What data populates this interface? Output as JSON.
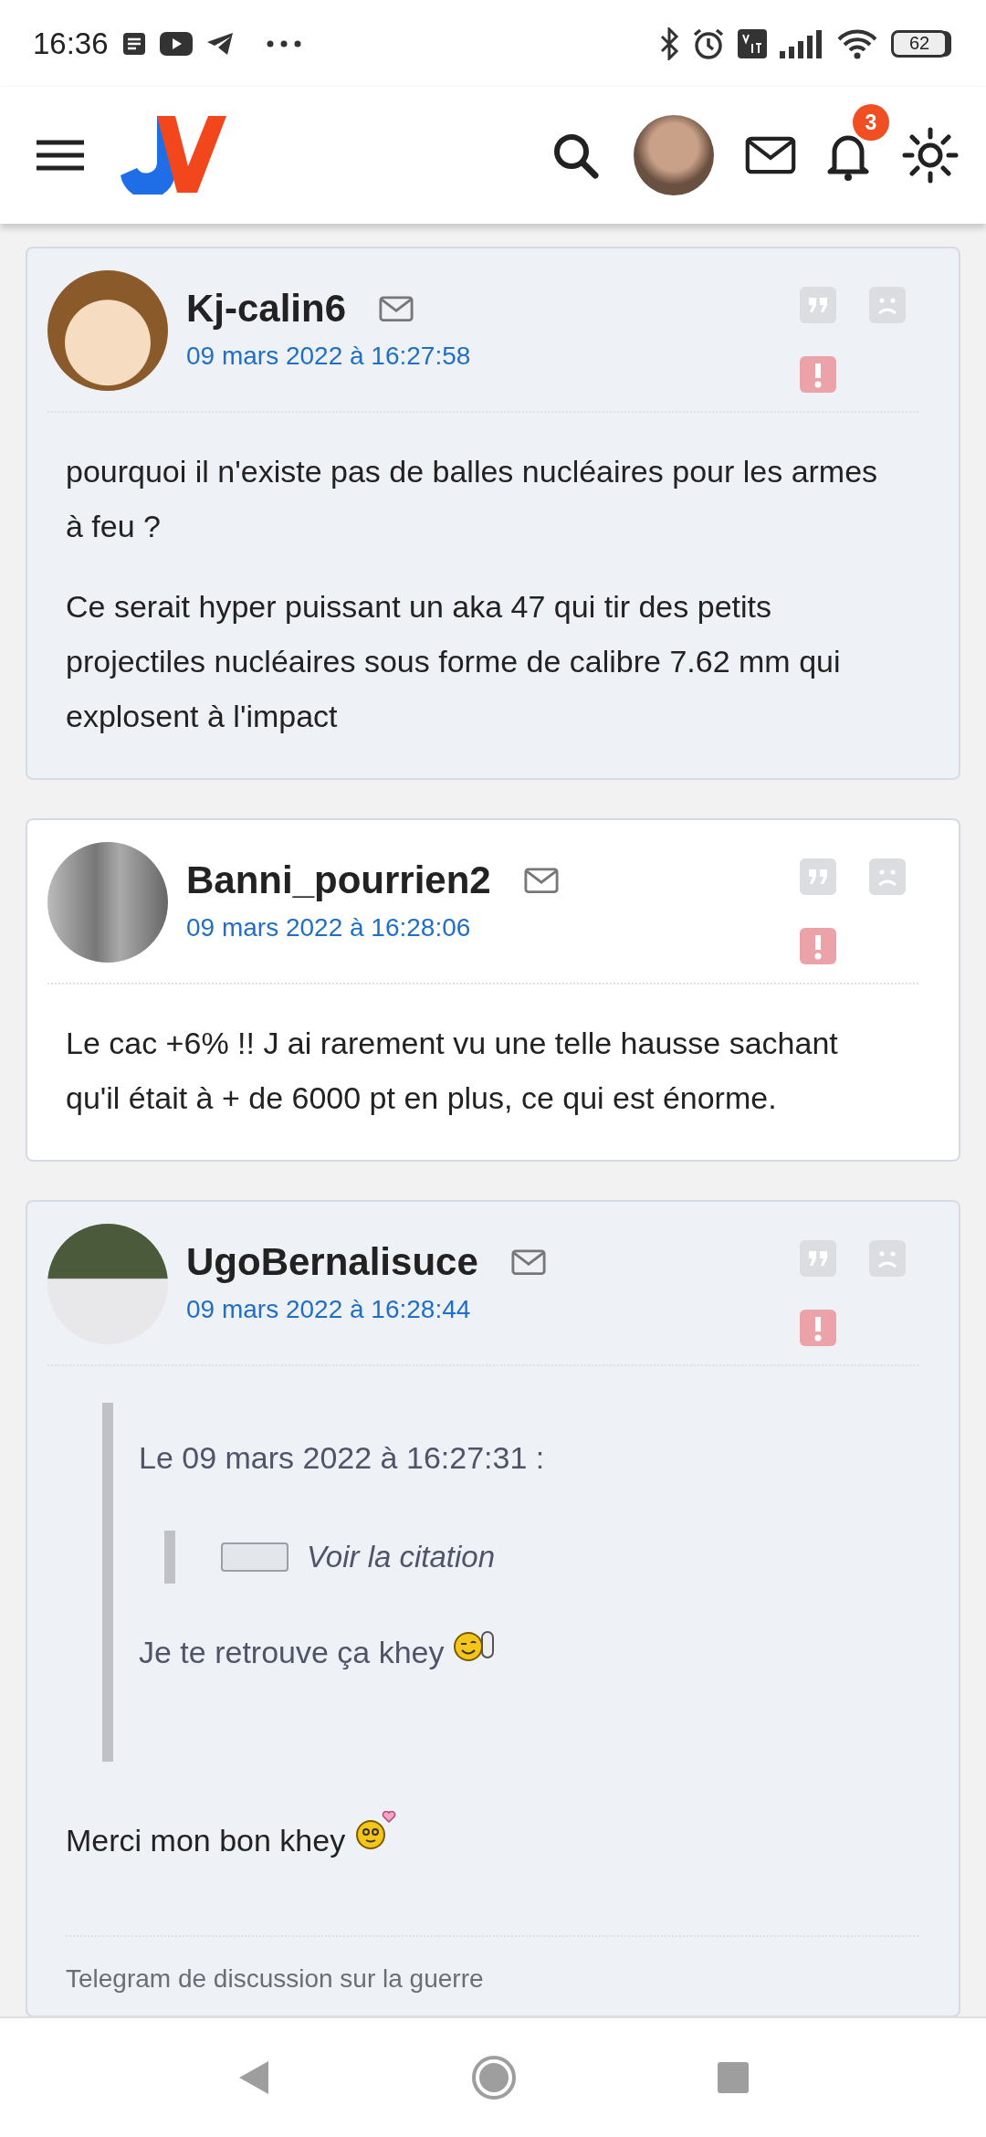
{
  "status_bar": {
    "time": "16:36",
    "battery": "62"
  },
  "header": {
    "notification_count": "3"
  },
  "posts": [
    {
      "author": "Kj-calin6",
      "date": "09 mars 2022 à 16:27:58",
      "avatar": {
        "kind": "drawing"
      },
      "blocks": [
        {
          "kind": "paragraph",
          "text": "pourquoi il n'existe pas de balles nucléaires pour les armes à feu ?"
        },
        {
          "kind": "paragraph",
          "text": "Ce serait hyper puissant un aka 47 qui tir des petits projectiles nucléaires sous forme de calibre 7.62 mm qui explosent à l'impact"
        }
      ]
    },
    {
      "author": "Banni_pourrien2",
      "date": "09 mars 2022 à 16:28:06",
      "avatar": {
        "kind": "silhouettes"
      },
      "blocks": [
        {
          "kind": "paragraph",
          "text": "Le cac +6% !! J ai rarement vu une telle hausse sachant qu'il était à + de 6000 pt en plus, ce qui est énorme."
        }
      ]
    },
    {
      "author": "UgoBernalisuce",
      "date": "09 mars 2022 à 16:28:44",
      "avatar": {
        "kind": "photo"
      },
      "blocks": [
        {
          "kind": "quote",
          "header": "Le 09 mars 2022 à 16:27:31 :",
          "collapsed_label": "Voir la citation",
          "text": "Je te retrouve ça khey",
          "smiley": {
            "kind": "wink"
          }
        },
        {
          "kind": "paragraph",
          "text": "Merci mon bon khey",
          "smiley": {
            "kind": "heart"
          }
        },
        {
          "kind": "signature",
          "text": "Telegram de discussion sur la guerre"
        }
      ]
    }
  ]
}
